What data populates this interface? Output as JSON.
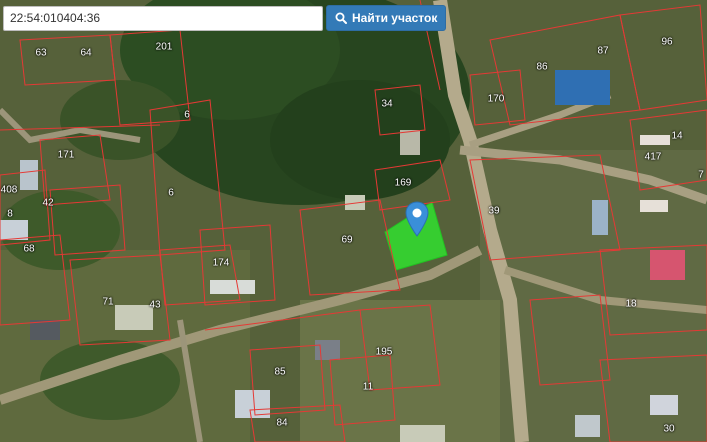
{
  "search": {
    "value": "22:54:010404:36",
    "button_label": "Найти участок",
    "button_icon": "search-icon"
  },
  "marker": {
    "icon": "map-pin-icon",
    "color": "#3a8fd9"
  },
  "selected_parcel": {
    "color": "#2ee82e"
  },
  "parcels": {
    "p63": "63",
    "p64": "64",
    "p201": "201",
    "p87": "87",
    "p96": "96",
    "p86": "86",
    "p34": "34",
    "p170": "170",
    "p6a": "6",
    "p14": "14",
    "p417": "417",
    "p171": "171",
    "p7": "7",
    "p6b": "6",
    "p169": "169",
    "p39": "39",
    "p408": "408",
    "p42": "42",
    "p8": "8",
    "p69": "69",
    "p68": "68",
    "p174": "174",
    "p71": "71",
    "p43": "43",
    "p18": "18",
    "p195": "195",
    "p85": "85",
    "p11": "11",
    "p84": "84",
    "p30": "30"
  },
  "colors": {
    "parcel_boundary": "#e53935",
    "button": "#337ab7"
  }
}
